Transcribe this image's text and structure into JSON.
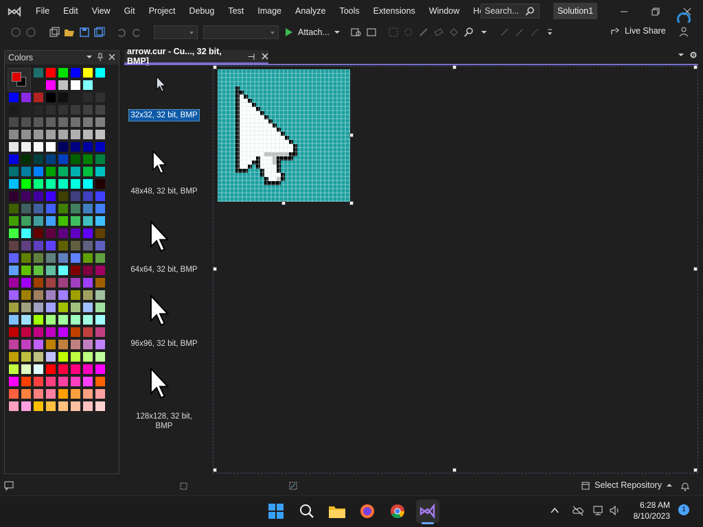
{
  "menu": {
    "items": [
      "File",
      "Edit",
      "View",
      "Git",
      "Project",
      "Debug",
      "Test",
      "Image",
      "Analyze",
      "Tools",
      "Extensions",
      "Window",
      "Help"
    ],
    "search_placeholder": "Search...",
    "solution_name": "Solution1"
  },
  "toolbar": {
    "attach_label": "Attach...",
    "live_share_label": "Live Share"
  },
  "colors_panel": {
    "title": "Colors",
    "foreground": "#e00000",
    "background": "#000000"
  },
  "document_tab": {
    "title": "arrow.cur - Cu..., 32 bit, BMP]"
  },
  "image_list": {
    "items": [
      {
        "label": "32x32, 32 bit, BMP",
        "selected": true
      },
      {
        "label": "48x48, 32 bit, BMP",
        "selected": false
      },
      {
        "label": "64x64, 32 bit, BMP",
        "selected": false
      },
      {
        "label": "96x96, 32 bit, BMP",
        "selected": false
      },
      {
        "label": "128x128, 32 bit, BMP",
        "selected": false
      }
    ]
  },
  "canvas": {
    "grid_color": "#1aa0a0",
    "pixel_size": "32x32"
  },
  "status_bar": {
    "select_repository_label": "Select Repository"
  },
  "taskbar": {
    "time": "6:28 AM",
    "date": "8/10/2023",
    "notification_count": "1"
  }
}
